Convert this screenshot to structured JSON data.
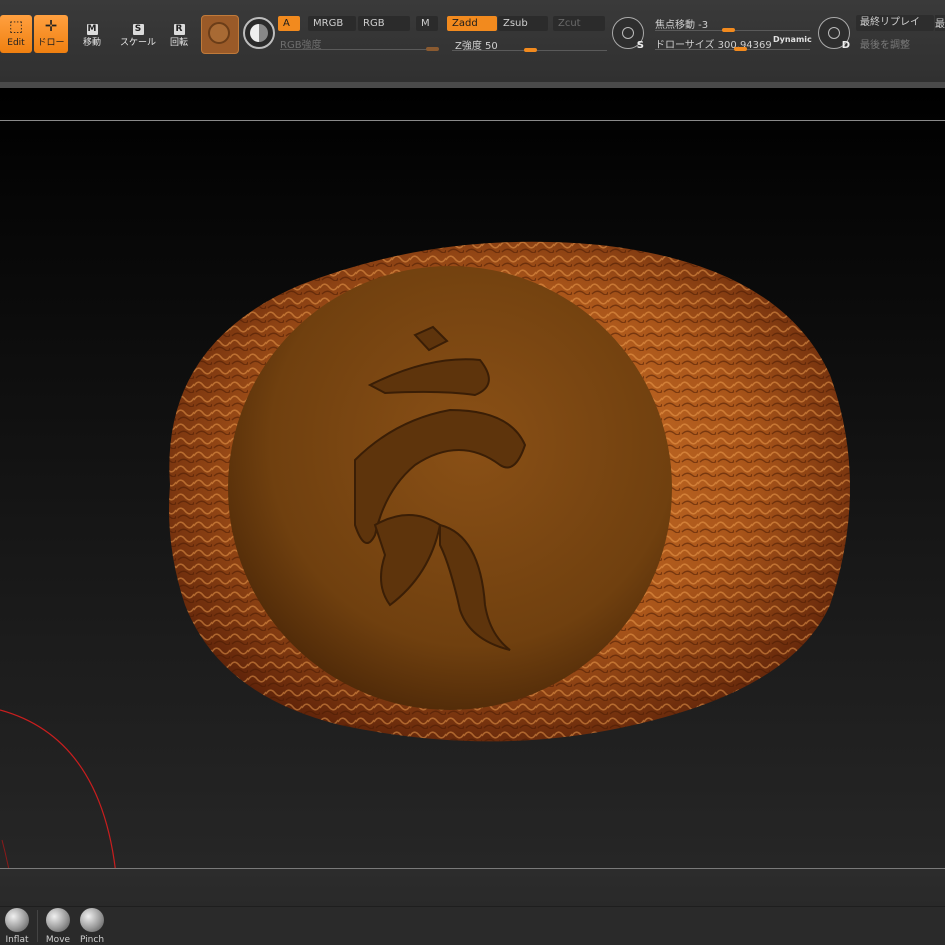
{
  "toolbar": {
    "edit_label": "Edit",
    "draw_label": "ドロー",
    "move_key": "M",
    "move_label": "移動",
    "scale_key": "S",
    "scale_label": "スケール",
    "rotate_key": "R",
    "rotate_label": "回転",
    "a_label": "A",
    "mrgb_label": "MRGB",
    "rgb_label": "RGB",
    "m_label": "M",
    "rgb_intensity_label": "RGB強度",
    "zadd_label": "Zadd",
    "zsub_label": "Zsub",
    "zcut_label": "Zcut",
    "z_intensity_label": "Z強度 50",
    "focal_shift_label": "焦点移動 -3",
    "draw_size_label": "ドローサイズ 300.94369",
    "dynamic_label": "Dynamic",
    "s_letter": "S",
    "d_letter": "D",
    "last_replay_label": "最終リプレイ",
    "last_adjust_label": "最後を調整",
    "edge_label": "最"
  },
  "sliders": {
    "rgb_intensity_fill": 0.97,
    "z_intensity_fill": 0.5,
    "focal_shift_fill": 0.47,
    "draw_size_fill": 0.55
  },
  "brushes": [
    {
      "label": "Inflat"
    },
    {
      "label": "Move"
    },
    {
      "label": "Pinch"
    }
  ],
  "colors": {
    "accent": "#f28a1e",
    "model": "#b5601a"
  }
}
